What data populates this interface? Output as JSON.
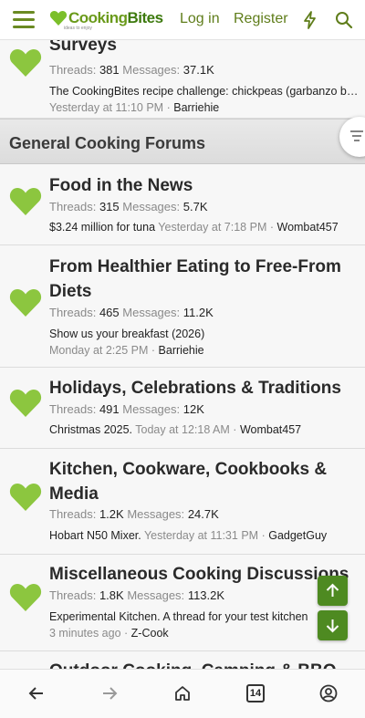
{
  "header": {
    "logo_main": "Cooking",
    "logo_accent": "Bites",
    "logo_tagline": "ideas to enjoy",
    "login_label": "Log in",
    "register_label": "Register",
    "icons": [
      "menu-icon",
      "bolt-icon",
      "search-icon"
    ],
    "accent_color": "#5f7d1a"
  },
  "top_forum": {
    "title": "Surveys",
    "threads_label": "Threads:",
    "threads": "381",
    "messages_label": "Messages:",
    "messages": "37.1K",
    "latest_title": "The CookingBites recipe challenge: chickpeas (garbanzo b…",
    "latest_time": "Yesterday at 11:10 PM",
    "sep": "·",
    "latest_user": "Barriehie"
  },
  "section": {
    "title": "General Cooking Forums"
  },
  "forums": [
    {
      "title": "Food in the News",
      "threads": "315",
      "messages": "5.7K",
      "latest_title": "$3.24 million for tuna",
      "latest_time": "Yesterday at 7:18 PM",
      "latest_user": "Wombat457"
    },
    {
      "title_line1": "From Healthier Eating to Free-From",
      "title_line2": "Diets",
      "threads": "465",
      "messages": "11.2K",
      "latest_title": "Show us your breakfast (2026)",
      "latest_time": "Monday at 2:25 PM",
      "latest_user": "Barriehie"
    },
    {
      "title": "Holidays, Celebrations & Traditions",
      "threads": "491",
      "messages": "12K",
      "latest_title": "Christmas 2025.",
      "latest_time": "Today at 12:18 AM",
      "latest_user": "Wombat457"
    },
    {
      "title_line1": "Kitchen, Cookware, Cookbooks &",
      "title_line2": "Media",
      "threads": "1.2K",
      "messages": "24.7K",
      "latest_title": "Hobart N50 Mixer.",
      "latest_time": "Yesterday at 11:31 PM",
      "latest_user": "GadgetGuy"
    },
    {
      "title": "Miscellaneous Cooking Discussions",
      "threads": "1.8K",
      "messages": "113.2K",
      "latest_title": "Experimental Kitchen. A thread for your test kitchen",
      "latest_time": "3 minutes ago",
      "latest_user": "Z-Cook"
    },
    {
      "title": "Outdoor Cooking, Camping & BBQ"
    }
  ],
  "bottom_bar": {
    "tab_count": "14",
    "icons": [
      "back-icon",
      "forward-icon",
      "home-icon",
      "tabs-icon",
      "account-icon"
    ]
  }
}
